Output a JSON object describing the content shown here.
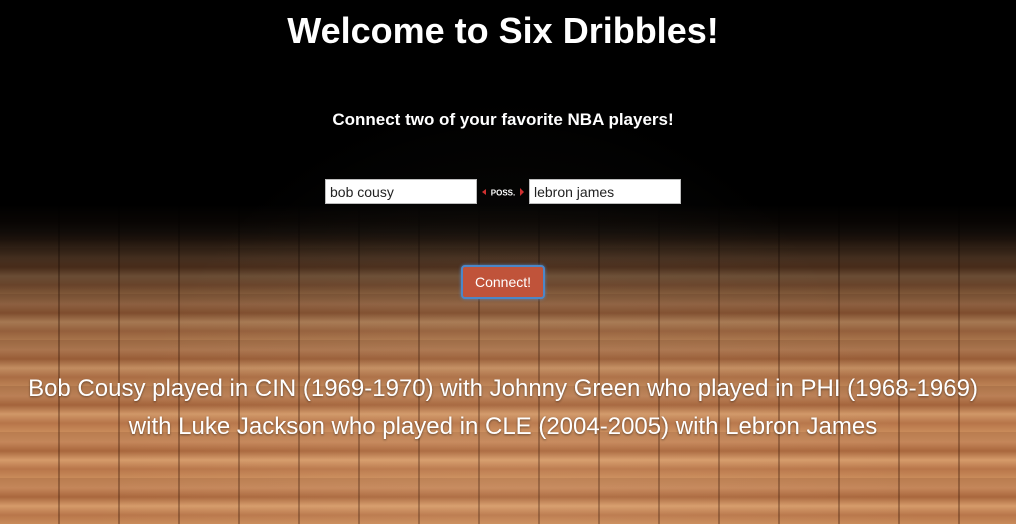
{
  "header": {
    "title": "Welcome to Six Dribbles!",
    "subtitle": "Connect two of your favorite NBA players!"
  },
  "form": {
    "player_a_value": "bob cousy",
    "connector_label": "POSS.",
    "player_b_value": "lebron james",
    "connect_label": "Connect!"
  },
  "result": {
    "text": "Bob Cousy played in CIN (1969-1970) with Johnny Green who played in PHI (1968-1969) with Luke Jackson who played in CLE (2004-2005) with Lebron James"
  },
  "colors": {
    "button": "#c0533a",
    "button_focus_ring": "#4b87c8",
    "connector_arrow": "#d03030"
  },
  "icons": {
    "connector": "possession-arrow-icon"
  }
}
